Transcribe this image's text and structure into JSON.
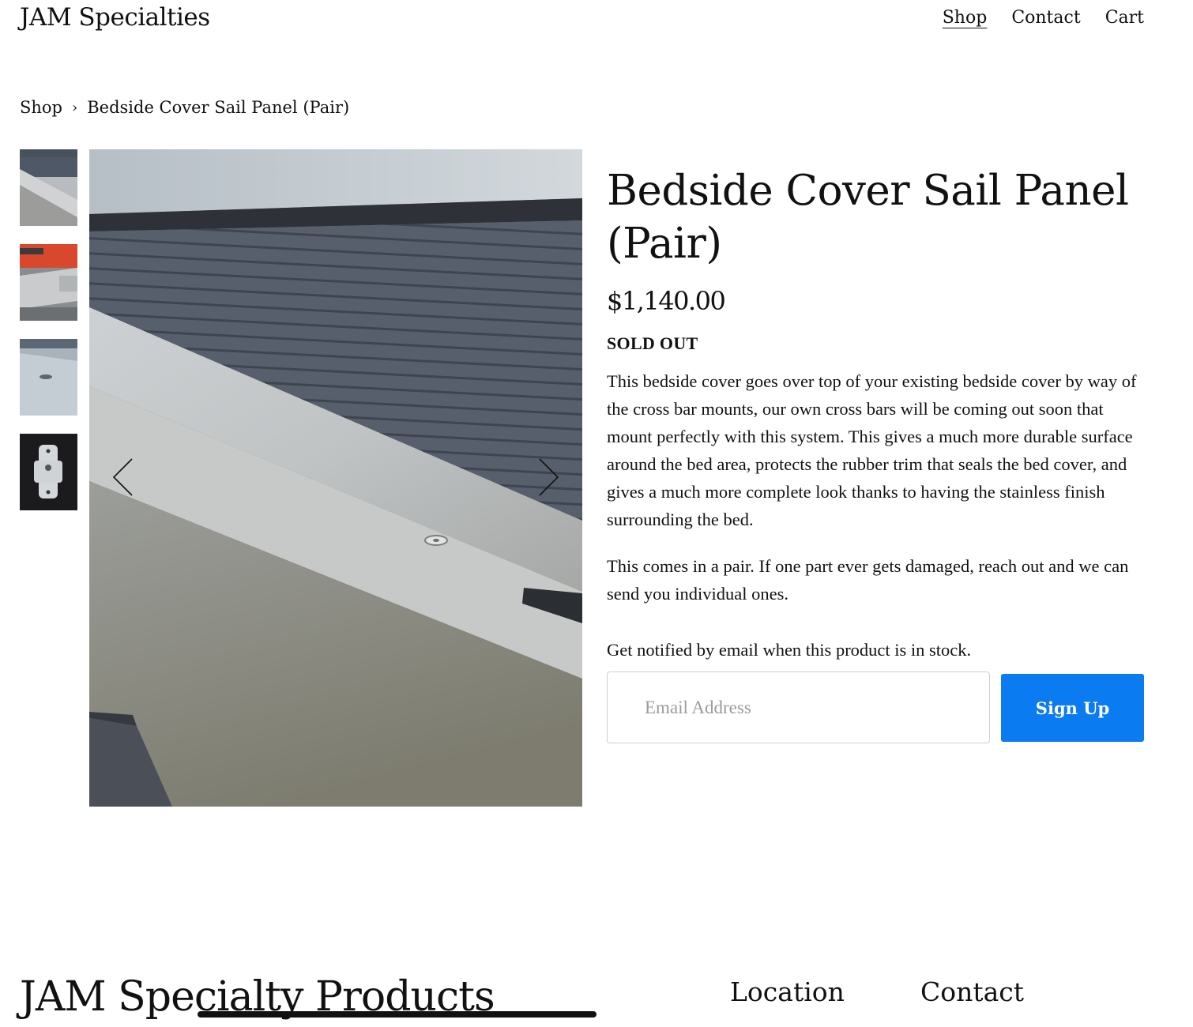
{
  "brand": "JAM Specialties",
  "nav": {
    "shop": "Shop",
    "contact": "Contact",
    "cart": "Cart"
  },
  "breadcrumb": {
    "parent": "Shop",
    "separator": "›",
    "current": "Bedside Cover Sail Panel (Pair)"
  },
  "product": {
    "title": "Bedside Cover Sail Panel (Pair)",
    "price": "$1,140.00",
    "stock_status": "SOLD OUT",
    "description": [
      "This bedside cover goes over top of your existing bedside cover by way of the cross bar mounts, our own cross bars will be coming out soon that mount perfectly with this system. This gives a much more durable surface around the bed area, protects the rubber trim that seals the bed cover, and gives a much more complete look thanks to having the stainless finish surrounding the bed.",
      "This comes in a pair. If one part ever gets damaged, reach out and we can send you individual ones."
    ],
    "thumbnails": [
      "thumbnail-image-1",
      "thumbnail-image-2",
      "thumbnail-image-3",
      "thumbnail-image-4"
    ]
  },
  "notify": {
    "text": "Get notified by email when this product is in stock.",
    "email_placeholder": "Email Address",
    "button_label": "Sign Up"
  },
  "footer": {
    "brand": "JAM Specialty Products",
    "location": "Location",
    "contact": "Contact"
  },
  "icons": {
    "prev": "chevron-left-icon",
    "next": "chevron-right-icon"
  },
  "colors": {
    "accent": "#0b7bf2",
    "text": "#111111"
  }
}
